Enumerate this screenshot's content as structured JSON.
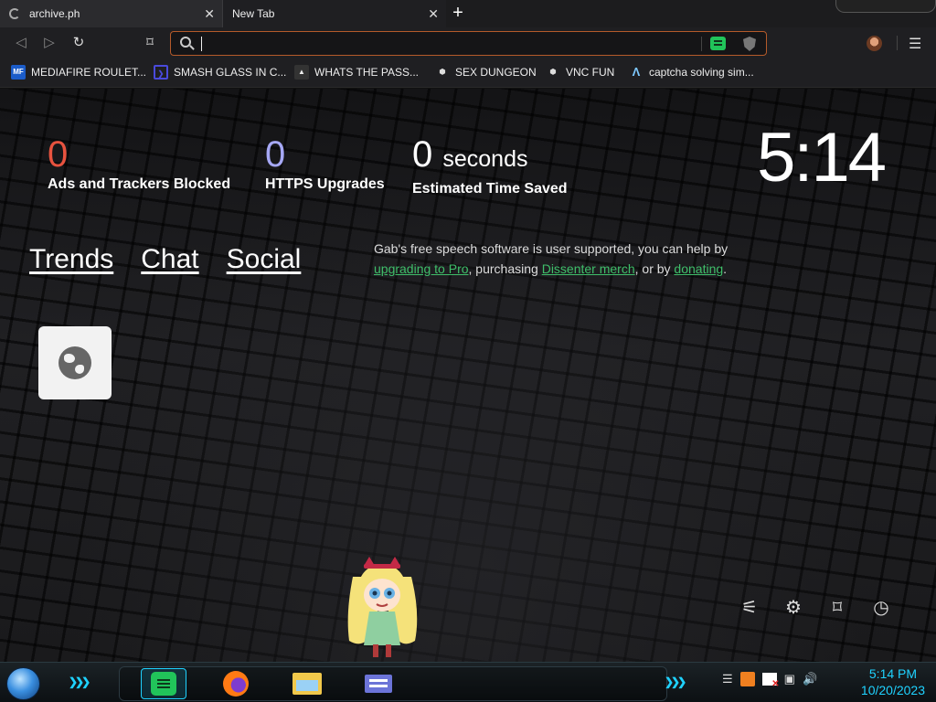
{
  "tabs": [
    {
      "title": "archive.ph",
      "loading": true
    },
    {
      "title": "New Tab",
      "loading": false
    }
  ],
  "address_bar": {
    "value": "",
    "placeholder": ""
  },
  "bookmarks": [
    {
      "label": "MEDIAFIRE ROULET...",
      "icon": "mediafire-icon"
    },
    {
      "label": "SMASH GLASS IN C...",
      "icon": "bracket-icon"
    },
    {
      "label": "WHATS THE PASS...",
      "icon": "lock-icon"
    },
    {
      "label": "SEX DUNGEON",
      "icon": "cube-icon"
    },
    {
      "label": "VNC FUN",
      "icon": "cube-icon"
    },
    {
      "label": "captcha solving sim...",
      "icon": "lambda-icon"
    }
  ],
  "stats": {
    "ads_blocked": {
      "value": "0",
      "label": "Ads and Trackers Blocked",
      "color": "#e8533f"
    },
    "https_upgrades": {
      "value": "0",
      "label": "HTTPS Upgrades",
      "color": "#a6a8f5"
    },
    "time_saved": {
      "value": "0",
      "unit": "seconds",
      "label": "Estimated Time Saved",
      "color": "#ffffff"
    }
  },
  "clock": "5:14",
  "quick_links": [
    "Trends",
    "Chat",
    "Social"
  ],
  "gab_message": {
    "part1": "Gab's free speech software is user supported, you can help by ",
    "link1": "upgrading to Pro",
    "part2": ", purchasing ",
    "link2": "Dissenter merch",
    "part3": ", or by ",
    "link3": "donating",
    "part4": "."
  },
  "ntp_tools": [
    "customize-icon",
    "settings-icon",
    "bookmarks-icon",
    "history-icon"
  ],
  "taskbar": {
    "apps": [
      "gab-icon",
      "firefox-icon",
      "file-explorer-icon",
      "card-app-icon"
    ],
    "time": "5:14 PM",
    "date": "10/20/2023"
  },
  "colors": {
    "accent": "#1fd2ff",
    "gab_green": "#21c45a",
    "url_border": "#b45a2a"
  }
}
